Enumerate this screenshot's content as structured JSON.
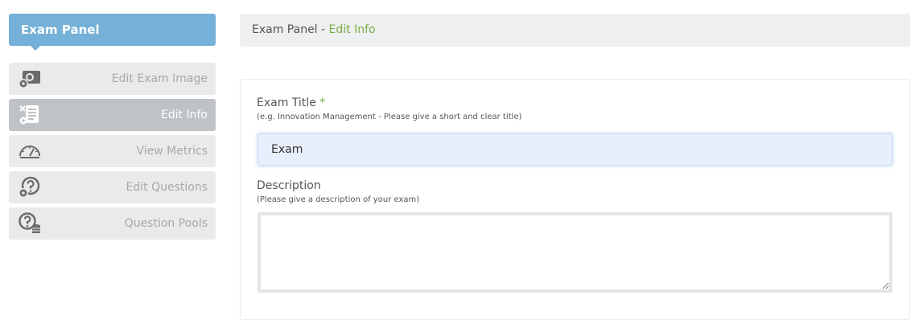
{
  "sidebar": {
    "header": "Exam Panel",
    "items": [
      {
        "label": "Edit Exam Image",
        "icon": "image-gear-icon",
        "active": false
      },
      {
        "label": "Edit Info",
        "icon": "document-gear-icon",
        "active": true
      },
      {
        "label": "View Metrics",
        "icon": "speedometer-icon",
        "active": false
      },
      {
        "label": "Edit Questions",
        "icon": "question-gear-icon",
        "active": false
      },
      {
        "label": "Question Pools",
        "icon": "question-database-icon",
        "active": false
      }
    ]
  },
  "breadcrumb": {
    "root": "Exam Panel",
    "separator": " - ",
    "current": "Edit Info"
  },
  "form": {
    "title_label": "Exam Title",
    "required_marker": "*",
    "title_hint": "(e.g. Innovation Management - Please give a short and clear title)",
    "title_value": "Exam",
    "description_label": "Description",
    "description_hint": "(Please give a description of your exam)",
    "description_value": ""
  },
  "colors": {
    "header_blue": "#74b0d7",
    "accent_green": "#79ad46",
    "item_bg": "#eaeaea",
    "item_active_bg": "#bfc2c6"
  }
}
